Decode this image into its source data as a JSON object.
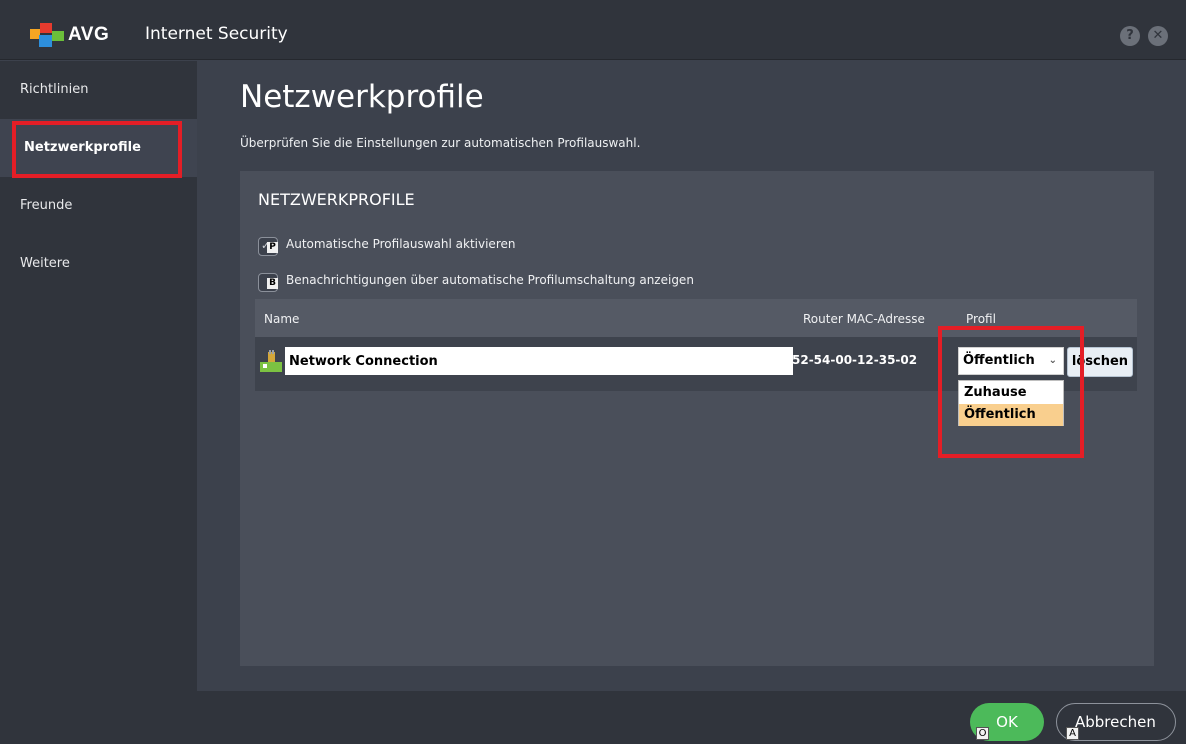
{
  "titlebar": {
    "logo_text": "AVG",
    "app_title": "Internet Security",
    "help_label": "?",
    "close_label": "✕"
  },
  "sidebar": {
    "items": [
      {
        "label": "Richtlinien"
      },
      {
        "label": "Netzwerkprofile",
        "active": true
      },
      {
        "label": "Freunde"
      },
      {
        "label": "Weitere"
      }
    ]
  },
  "main": {
    "title": "Netzwerkprofile",
    "description": "Überprüfen Sie die Einstellungen zur automatischen Profilauswahl.",
    "panel": {
      "title": "NETZWERKPROFILE",
      "checkboxes": [
        {
          "label": "Automatische Profilauswahl aktivieren",
          "key": "P",
          "checked": true
        },
        {
          "label": "Benachrichtigungen über automatische Profilumschaltung anzeigen",
          "key": "B",
          "checked": false
        }
      ],
      "table": {
        "columns": [
          "Name",
          "Router MAC-Adresse",
          "Profil"
        ],
        "rows": [
          {
            "name": "Network Connection",
            "mac": "52-54-00-12-35-02",
            "profile": "Öffentlich",
            "delete_label": "löschen"
          }
        ]
      },
      "profile_options": [
        "Zuhause",
        "Öffentlich"
      ],
      "profile_selected": "Öffentlich"
    }
  },
  "footer": {
    "ok_label": "OK",
    "ok_key": "O",
    "cancel_label": "Abbrechen",
    "cancel_key": "A"
  },
  "colors": {
    "highlight": "#e41e26",
    "ok_green": "#4cba5a",
    "selected_option": "#f9cf8e"
  }
}
